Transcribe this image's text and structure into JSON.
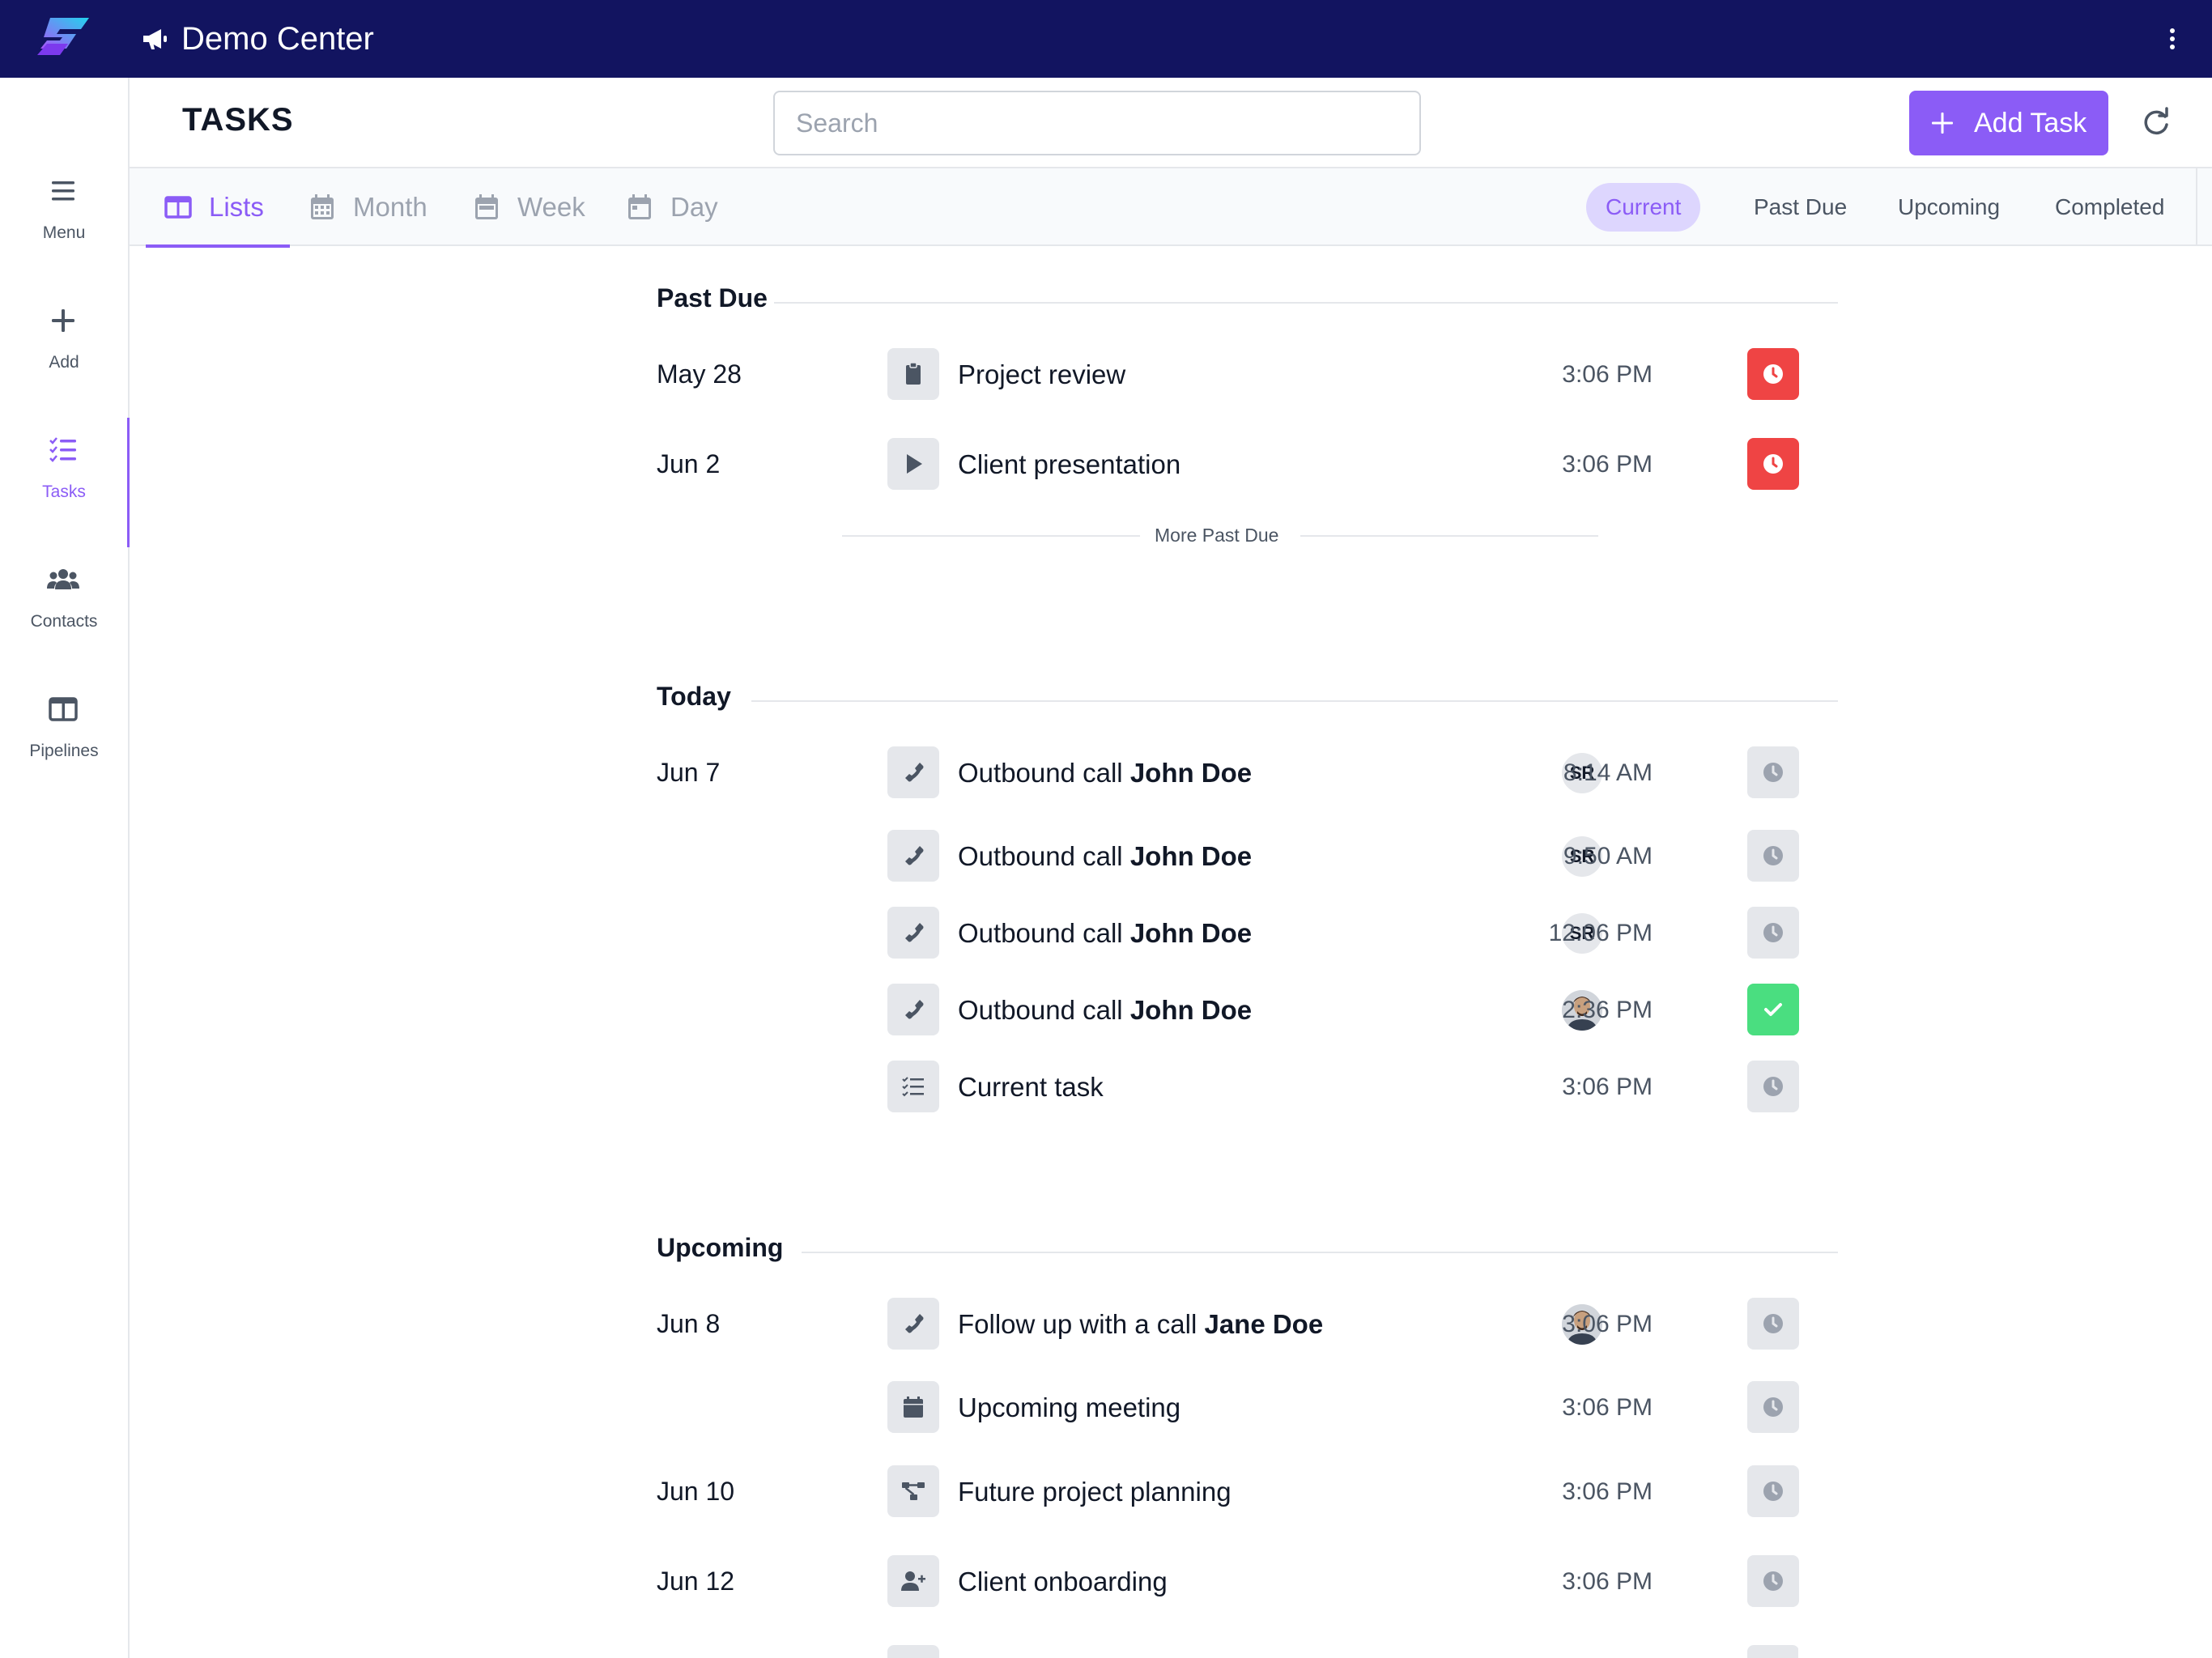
{
  "app": {
    "title": "Demo Center"
  },
  "sidebar": {
    "items": [
      {
        "label": "Menu",
        "icon": "menu-icon"
      },
      {
        "label": "Add",
        "icon": "plus-icon"
      },
      {
        "label": "Tasks",
        "icon": "tasks-icon",
        "active": true
      },
      {
        "label": "Contacts",
        "icon": "contacts-icon"
      },
      {
        "label": "Pipelines",
        "icon": "pipelines-icon"
      }
    ]
  },
  "header": {
    "page_title": "TASKS",
    "search_placeholder": "Search",
    "add_task_label": "Add Task"
  },
  "view_tabs": [
    {
      "label": "Lists",
      "active": true
    },
    {
      "label": "Month"
    },
    {
      "label": "Week"
    },
    {
      "label": "Day"
    }
  ],
  "filters": [
    {
      "label": "Current",
      "active": true
    },
    {
      "label": "Past Due"
    },
    {
      "label": "Upcoming"
    },
    {
      "label": "Completed"
    }
  ],
  "sections": {
    "past_due": {
      "title": "Past Due",
      "more_label": "More Past Due",
      "rows": [
        {
          "date": "May 28",
          "icon": "clipboard-icon",
          "title": "Project review",
          "time": "3:06 PM",
          "status": "overdue"
        },
        {
          "date": "Jun 2",
          "icon": "play-icon",
          "title": "Client presentation",
          "time": "3:06 PM",
          "status": "overdue"
        }
      ]
    },
    "today": {
      "title": "Today",
      "rows": [
        {
          "date": "Jun 7",
          "icon": "phone-icon",
          "title": "Outbound call",
          "contact": "John Doe",
          "avatar": "SR",
          "time": "8:14 AM",
          "status": "pending"
        },
        {
          "date": "",
          "icon": "phone-icon",
          "title": "Outbound call",
          "contact": "John Doe",
          "avatar": "SR",
          "time": "9:50 AM",
          "status": "pending"
        },
        {
          "date": "",
          "icon": "phone-icon",
          "title": "Outbound call",
          "contact": "John Doe",
          "avatar": "SR",
          "time": "12:06 PM",
          "status": "pending"
        },
        {
          "date": "",
          "icon": "phone-icon",
          "title": "Outbound call",
          "contact": "John Doe",
          "avatar": "photo",
          "time": "2:36 PM",
          "status": "done"
        },
        {
          "date": "",
          "icon": "checklist-icon",
          "title": "Current task",
          "time": "3:06 PM",
          "status": "pending"
        }
      ]
    },
    "upcoming": {
      "title": "Upcoming",
      "rows": [
        {
          "date": "Jun 8",
          "icon": "phone-icon",
          "title": "Follow up with a call",
          "contact": "Jane Doe",
          "avatar": "photo",
          "time": "3:06 PM",
          "status": "pending"
        },
        {
          "date": "",
          "icon": "calendar-icon",
          "title": "Upcoming meeting",
          "time": "3:06 PM",
          "status": "pending"
        },
        {
          "date": "Jun 10",
          "icon": "diagram-icon",
          "title": "Future project planning",
          "time": "3:06 PM",
          "status": "pending"
        },
        {
          "date": "Jun 12",
          "icon": "user-plus-icon",
          "title": "Client onboarding",
          "time": "3:06 PM",
          "status": "pending"
        }
      ]
    }
  },
  "colors": {
    "topbar": "#121460",
    "accent": "#8b5cf6",
    "overdue": "#ef4444",
    "done": "#4ade80"
  }
}
